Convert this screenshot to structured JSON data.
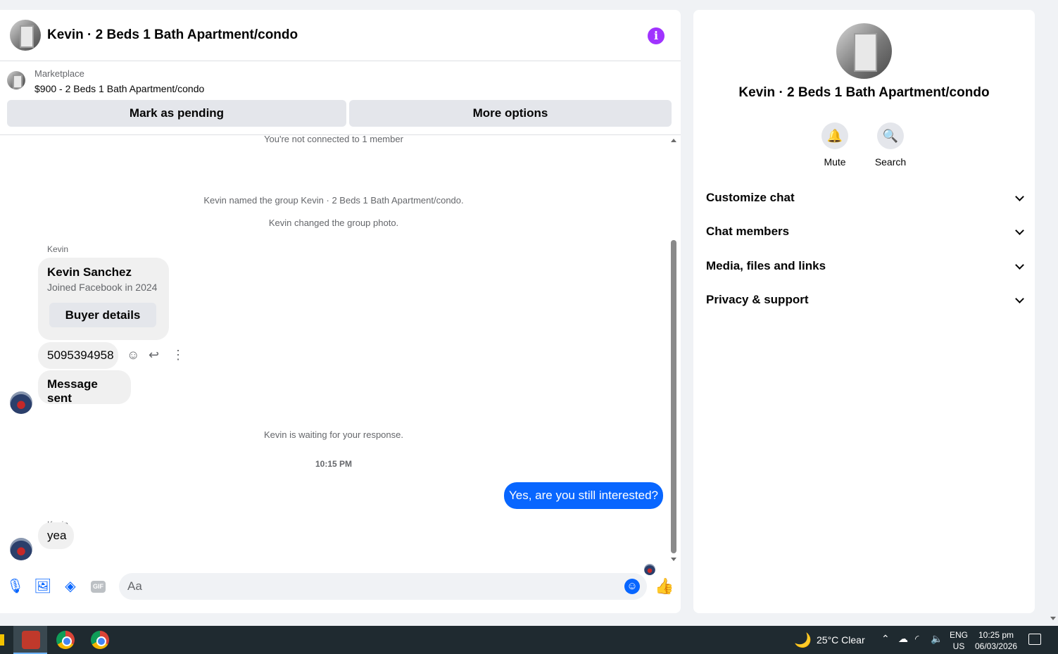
{
  "chat": {
    "title": "Kevin · 2 Beds 1 Bath Apartment/condo",
    "marketplace_label": "Marketplace",
    "listing": "$900 - 2 Beds 1 Bath Apartment/condo",
    "mark_pending_label": "Mark as pending",
    "more_options_label": "More options"
  },
  "messages": {
    "not_connected": "You're not connected to 1 member",
    "named_group": "Kevin named the group Kevin · 2 Beds 1 Bath Apartment/condo.",
    "changed_photo": "Kevin changed the group photo.",
    "sender_1": "Kevin",
    "card_name": "Kevin Sanchez",
    "card_sub": "Joined Facebook in 2024",
    "card_button": "Buyer details",
    "phone": "5095394958",
    "sent": "Message sent",
    "waiting": "Kevin is waiting for your response.",
    "timestamp": "10:15 PM",
    "outgoing": "Yes, are you still interested?",
    "sender_2": "Kevin",
    "reply": "yea"
  },
  "composer": {
    "placeholder": "Aa",
    "gif_label": "GIF",
    "icons": [
      "microphone-icon",
      "photo-icon",
      "sticker-icon",
      "gif-icon",
      "emoji-icon",
      "thumbs-up-icon"
    ]
  },
  "info_panel": {
    "title": "Kevin · 2 Beds 1 Bath Apartment/condo",
    "mute_label": "Mute",
    "search_label": "Search",
    "sections": [
      "Customize chat",
      "Chat members",
      "Media, files and links",
      "Privacy & support"
    ]
  },
  "taskbar": {
    "weather": "25°C  Clear",
    "lang_1": "ENG",
    "lang_2": "US",
    "time": "10:25 pm",
    "date": "06/03/2026"
  },
  "colors": {
    "accent": "#0866ff",
    "info_icon": "#a033ff",
    "bubble": "#f0f0f0"
  }
}
